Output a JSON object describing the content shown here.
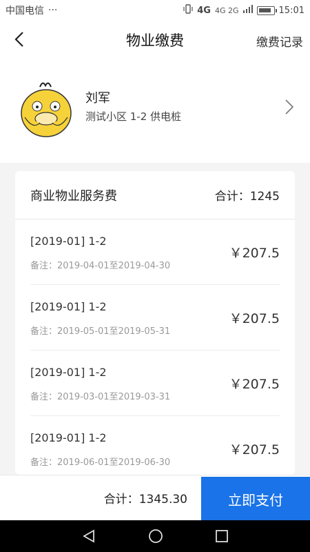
{
  "status_bar": {
    "carrier": "中国电信",
    "dots": "···",
    "network": "4G",
    "network_small": "4G 2G",
    "time": "15:01"
  },
  "nav": {
    "title": "物业缴费",
    "right_link": "缴费记录"
  },
  "user": {
    "name": "刘军",
    "address": "测试小区 1-2 供电桩"
  },
  "bill": {
    "title": "商业物业服务费",
    "total_label": "合计：",
    "total_value": "1245",
    "items": [
      {
        "period": "[2019-01] 1-2",
        "note_label": "备注：",
        "note": "2019-04-01至2019-04-30",
        "amount": "￥207.5"
      },
      {
        "period": "[2019-01] 1-2",
        "note_label": "备注：",
        "note": "2019-05-01至2019-05-31",
        "amount": "￥207.5"
      },
      {
        "period": "[2019-01] 1-2",
        "note_label": "备注：",
        "note": "2019-03-01至2019-03-31",
        "amount": "￥207.5"
      },
      {
        "period": "[2019-01] 1-2",
        "note_label": "备注：",
        "note": "2019-06-01至2019-06-30",
        "amount": "￥207.5"
      }
    ]
  },
  "footer": {
    "total_label": "合计：",
    "total_value": "1345.30",
    "pay_button": "立即支付"
  },
  "colors": {
    "accent": "#1a73e8",
    "background": "#f4f4f4"
  }
}
